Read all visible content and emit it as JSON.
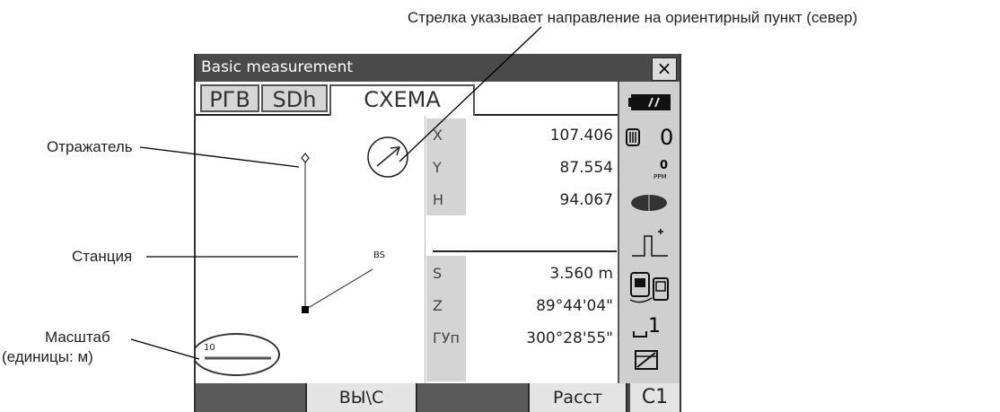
{
  "annotations": {
    "arrow_note": "Стрелка указывает направление на ориентирный пункт (север)",
    "reflector": "Отражатель",
    "station": "Станция",
    "scale_line1": "Масштаб",
    "scale_line2": "(единицы: м)"
  },
  "window": {
    "title": "Basic measurement",
    "close": "×"
  },
  "tabs": [
    "РГВ",
    "SDh",
    "СХЕМА"
  ],
  "graph": {
    "bs_label": "BS",
    "scale_value": "10"
  },
  "coords": [
    {
      "label": "X",
      "value": "107.406"
    },
    {
      "label": "Y",
      "value": "87.554"
    },
    {
      "label": "H",
      "value": "94.067"
    }
  ],
  "measurements": [
    {
      "label": "S",
      "value": "3.560 m"
    },
    {
      "label": "Z",
      "value": "89°44'04\""
    },
    {
      "label": "ГУп",
      "value": "300°28'55\""
    }
  ],
  "status": {
    "prism_constant": "0",
    "ppm_value": "0",
    "ppm_unit": "PPM",
    "channel": "1"
  },
  "softkeys": [
    "",
    "ВЫ\\С",
    "",
    "Расст",
    "C1"
  ]
}
